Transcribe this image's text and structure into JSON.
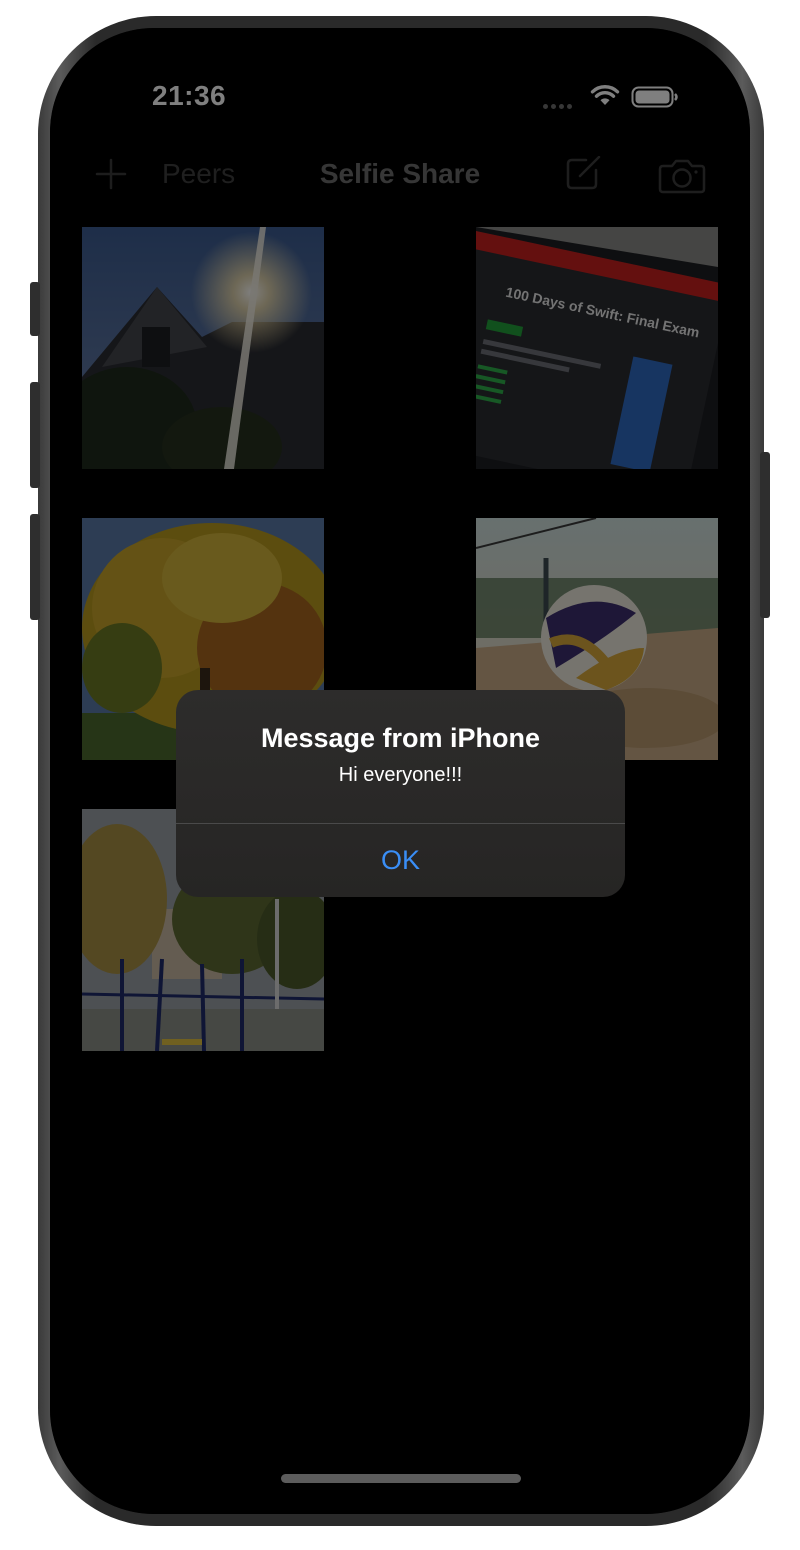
{
  "status_bar": {
    "time": "21:36"
  },
  "nav_bar": {
    "add_icon": "plus-icon",
    "peers_label": "Peers",
    "title": "Selfie Share",
    "compose_icon": "compose-icon",
    "camera_icon": "camera-icon"
  },
  "photos": [
    {
      "subject": "house-with-sun-flare"
    },
    {
      "subject": "monitor-100-days-of-swift-final-exam",
      "screen_text": {
        "heading": "100 Days of Swift: Final Exam"
      }
    },
    {
      "subject": "autumn-tree"
    },
    {
      "subject": "volleyball-on-sand"
    },
    {
      "subject": "playground-with-trees"
    }
  ],
  "alert": {
    "title": "Message from iPhone",
    "message": "Hi everyone!!!",
    "ok_label": "OK"
  },
  "colors": {
    "accent": "#3a8ef6",
    "background": "#000000",
    "alert_background": "#2a2928"
  }
}
